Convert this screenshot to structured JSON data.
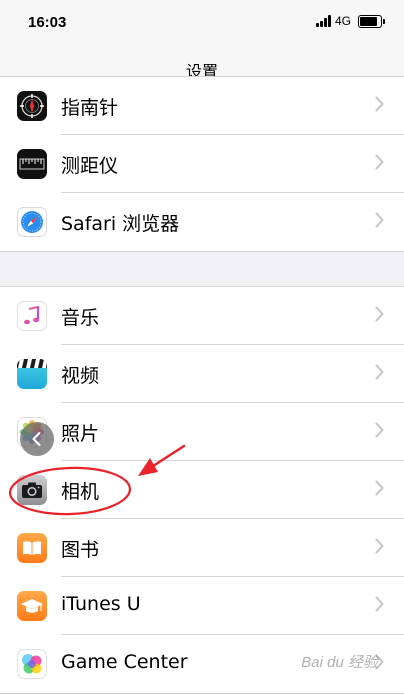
{
  "status_bar": {
    "time": "16:03",
    "network": "4G"
  },
  "nav": {
    "title": "设置"
  },
  "group1": [
    {
      "label": "指南针",
      "icon": "compass-icon"
    },
    {
      "label": "测距仪",
      "icon": "measure-icon"
    },
    {
      "label": "Safari 浏览器",
      "icon": "safari-icon"
    }
  ],
  "group2": [
    {
      "label": "音乐",
      "icon": "music-icon"
    },
    {
      "label": "视频",
      "icon": "videos-icon"
    },
    {
      "label": "照片",
      "icon": "photos-icon"
    },
    {
      "label": "相机",
      "icon": "camera-icon"
    },
    {
      "label": "图书",
      "icon": "books-icon"
    },
    {
      "label": "iTunes U",
      "icon": "itunes-u-icon"
    },
    {
      "label": "Game Center",
      "icon": "game-center-icon"
    }
  ],
  "colors": {
    "annotation_red": "#e8242a",
    "separator": "#d6d6d9",
    "background": "#efeff4"
  },
  "watermark": "Bai du 经验"
}
